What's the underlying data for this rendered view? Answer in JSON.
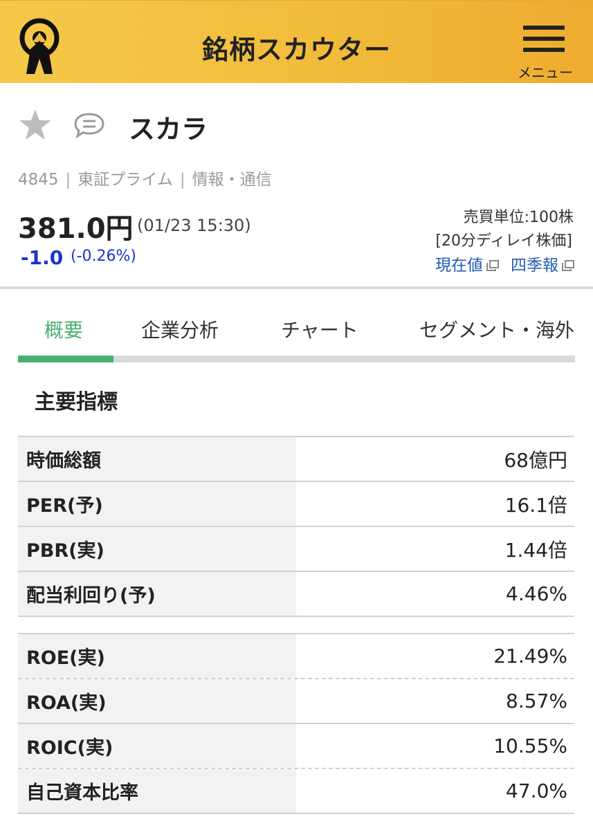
{
  "app": {
    "title": "銘柄スカウター",
    "menu_label": "メニュー"
  },
  "stock": {
    "name": "スカラ",
    "code": "4845",
    "market": "東証プライム",
    "sector": "情報・通信",
    "price": "381.0円",
    "datetime": "(01/23 15:30)",
    "change": "-1.0",
    "change_pct": "(-0.26%)",
    "trade_unit": "売買単位:100株",
    "delay_note": "[20分ディレイ株価]",
    "link_current": "現在値",
    "link_quarterly": "四季報",
    "change_color": "#1a33cc"
  },
  "tabs": [
    {
      "label": "概要",
      "active": true
    },
    {
      "label": "企業分析",
      "active": false
    },
    {
      "label": "チャート",
      "active": false
    },
    {
      "label": "セグメント・海外",
      "active": false
    }
  ],
  "section_title": "主要指標",
  "metrics_group1": [
    {
      "label": "時価総額",
      "value": "68億円"
    },
    {
      "label": "PER(予)",
      "value": "16.1倍"
    },
    {
      "label": "PBR(実)",
      "value": "1.44倍"
    },
    {
      "label": "配当利回り(予)",
      "value": "4.46%"
    }
  ],
  "metrics_group2": [
    {
      "label": "ROE(実)",
      "value": "21.49%"
    },
    {
      "label": "ROA(実)",
      "value": "8.57%"
    },
    {
      "label": "ROIC(実)",
      "value": "10.55%"
    },
    {
      "label": "自己資本比率",
      "value": "47.0%"
    }
  ],
  "colors": {
    "header_bg": "#f2bd3c",
    "accent_tab": "#4caf72",
    "link": "#1f5fb3"
  },
  "icons": [
    "logo-icon",
    "menu-icon",
    "star-icon",
    "comment-icon",
    "external-link-icon"
  ]
}
